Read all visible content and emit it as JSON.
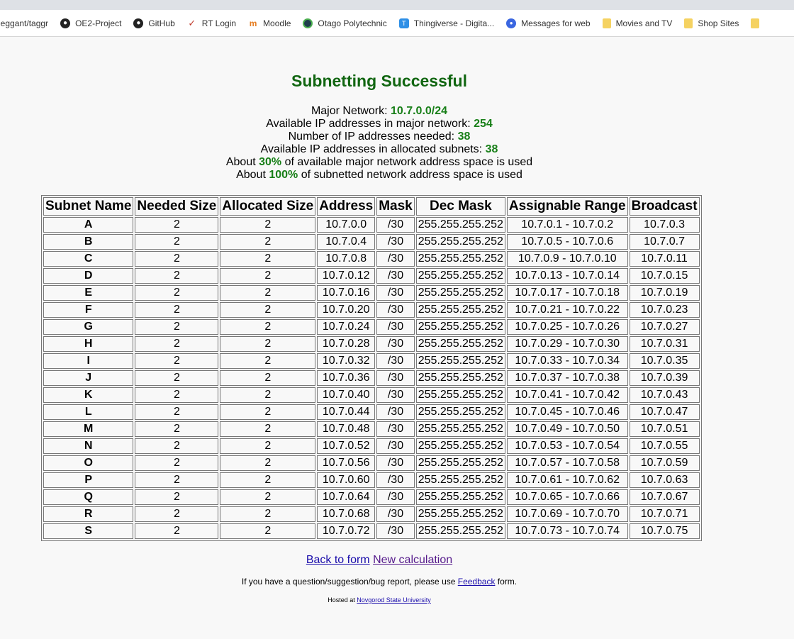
{
  "bookmarks": [
    {
      "label": "leggant/taggr",
      "icon": "github-icon"
    },
    {
      "label": "OE2-Project",
      "icon": "github-icon"
    },
    {
      "label": "GitHub",
      "icon": "github-icon"
    },
    {
      "label": "RT Login",
      "icon": "checkmark-icon"
    },
    {
      "label": "Moodle",
      "icon": "moodle-icon"
    },
    {
      "label": "Otago Polytechnic",
      "icon": "otago-icon"
    },
    {
      "label": "Thingiverse - Digita...",
      "icon": "thingiverse-icon"
    },
    {
      "label": "Messages for web",
      "icon": "messages-icon"
    },
    {
      "label": "Movies and TV",
      "icon": "folder-icon"
    },
    {
      "label": "Shop Sites",
      "icon": "folder-icon"
    }
  ],
  "page": {
    "title": "Subnetting Successful",
    "stats": {
      "major_network_label": "Major Network: ",
      "major_network": "10.7.0.0/24",
      "available_major_label": "Available IP addresses in major network: ",
      "available_major": "254",
      "needed_label": "Number of IP addresses needed: ",
      "needed": "38",
      "available_allocated_label": "Available IP addresses in allocated subnets: ",
      "available_allocated": "38",
      "about1_prefix": "About ",
      "about1_value": "30%",
      "about1_suffix": " of available major network address space is used",
      "about2_prefix": "About ",
      "about2_value": "100%",
      "about2_suffix": " of subnetted network address space is used"
    },
    "table": {
      "headers": [
        "Subnet Name",
        "Needed Size",
        "Allocated Size",
        "Address",
        "Mask",
        "Dec Mask",
        "Assignable Range",
        "Broadcast"
      ],
      "rows": [
        [
          "A",
          "2",
          "2",
          "10.7.0.0",
          "/30",
          "255.255.255.252",
          "10.7.0.1 - 10.7.0.2",
          "10.7.0.3"
        ],
        [
          "B",
          "2",
          "2",
          "10.7.0.4",
          "/30",
          "255.255.255.252",
          "10.7.0.5 - 10.7.0.6",
          "10.7.0.7"
        ],
        [
          "C",
          "2",
          "2",
          "10.7.0.8",
          "/30",
          "255.255.255.252",
          "10.7.0.9 - 10.7.0.10",
          "10.7.0.11"
        ],
        [
          "D",
          "2",
          "2",
          "10.7.0.12",
          "/30",
          "255.255.255.252",
          "10.7.0.13 - 10.7.0.14",
          "10.7.0.15"
        ],
        [
          "E",
          "2",
          "2",
          "10.7.0.16",
          "/30",
          "255.255.255.252",
          "10.7.0.17 - 10.7.0.18",
          "10.7.0.19"
        ],
        [
          "F",
          "2",
          "2",
          "10.7.0.20",
          "/30",
          "255.255.255.252",
          "10.7.0.21 - 10.7.0.22",
          "10.7.0.23"
        ],
        [
          "G",
          "2",
          "2",
          "10.7.0.24",
          "/30",
          "255.255.255.252",
          "10.7.0.25 - 10.7.0.26",
          "10.7.0.27"
        ],
        [
          "H",
          "2",
          "2",
          "10.7.0.28",
          "/30",
          "255.255.255.252",
          "10.7.0.29 - 10.7.0.30",
          "10.7.0.31"
        ],
        [
          "I",
          "2",
          "2",
          "10.7.0.32",
          "/30",
          "255.255.255.252",
          "10.7.0.33 - 10.7.0.34",
          "10.7.0.35"
        ],
        [
          "J",
          "2",
          "2",
          "10.7.0.36",
          "/30",
          "255.255.255.252",
          "10.7.0.37 - 10.7.0.38",
          "10.7.0.39"
        ],
        [
          "K",
          "2",
          "2",
          "10.7.0.40",
          "/30",
          "255.255.255.252",
          "10.7.0.41 - 10.7.0.42",
          "10.7.0.43"
        ],
        [
          "L",
          "2",
          "2",
          "10.7.0.44",
          "/30",
          "255.255.255.252",
          "10.7.0.45 - 10.7.0.46",
          "10.7.0.47"
        ],
        [
          "M",
          "2",
          "2",
          "10.7.0.48",
          "/30",
          "255.255.255.252",
          "10.7.0.49 - 10.7.0.50",
          "10.7.0.51"
        ],
        [
          "N",
          "2",
          "2",
          "10.7.0.52",
          "/30",
          "255.255.255.252",
          "10.7.0.53 - 10.7.0.54",
          "10.7.0.55"
        ],
        [
          "O",
          "2",
          "2",
          "10.7.0.56",
          "/30",
          "255.255.255.252",
          "10.7.0.57 - 10.7.0.58",
          "10.7.0.59"
        ],
        [
          "P",
          "2",
          "2",
          "10.7.0.60",
          "/30",
          "255.255.255.252",
          "10.7.0.61 - 10.7.0.62",
          "10.7.0.63"
        ],
        [
          "Q",
          "2",
          "2",
          "10.7.0.64",
          "/30",
          "255.255.255.252",
          "10.7.0.65 - 10.7.0.66",
          "10.7.0.67"
        ],
        [
          "R",
          "2",
          "2",
          "10.7.0.68",
          "/30",
          "255.255.255.252",
          "10.7.0.69 - 10.7.0.70",
          "10.7.0.71"
        ],
        [
          "S",
          "2",
          "2",
          "10.7.0.72",
          "/30",
          "255.255.255.252",
          "10.7.0.73 - 10.7.0.74",
          "10.7.0.75"
        ]
      ]
    },
    "links": {
      "back": "Back to form",
      "new_calc": "New calculation"
    },
    "note": {
      "prefix": "If you have a question/suggestion/bug report, please use ",
      "link": "Feedback",
      "suffix": " form."
    },
    "hosted": {
      "prefix": "Hosted at ",
      "link": "Novgorod State University"
    }
  },
  "colors": {
    "title_green": "#116611",
    "value_green": "#187f18",
    "link_blue": "#1a0dab",
    "link_visited": "#551a8b"
  }
}
